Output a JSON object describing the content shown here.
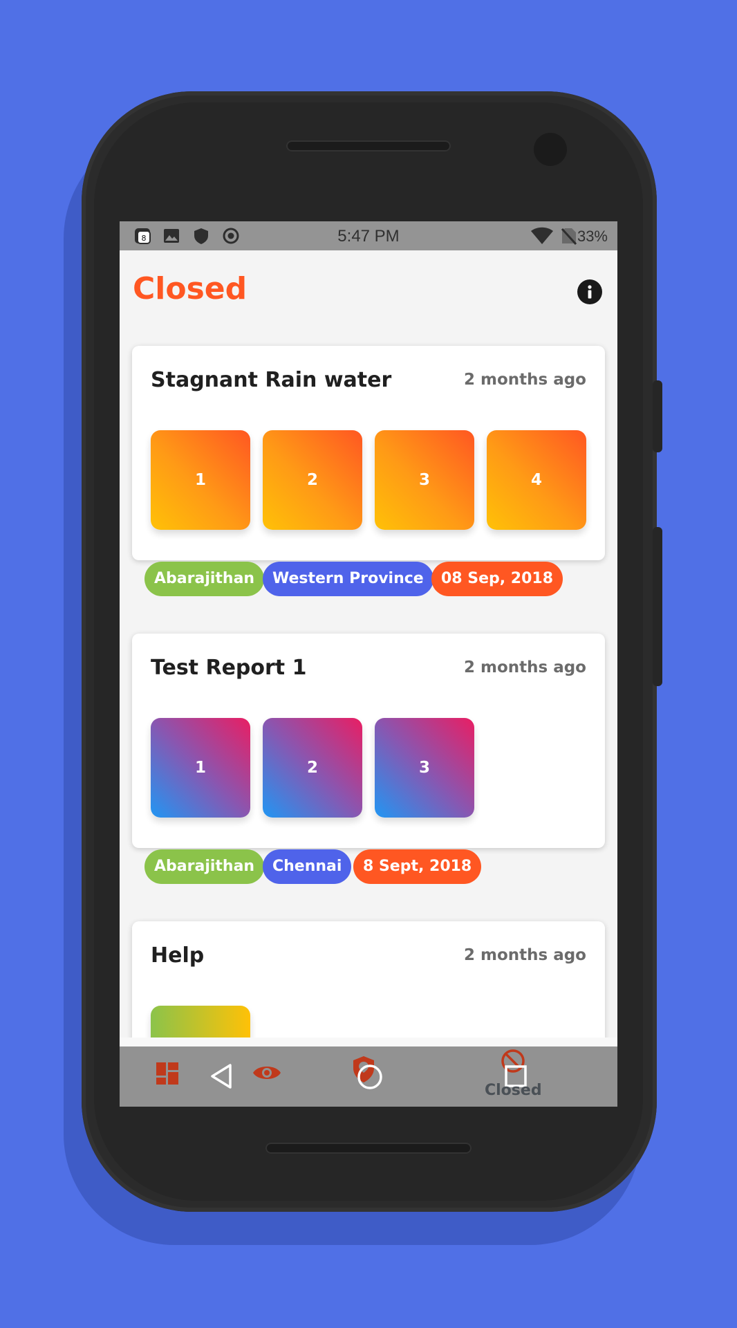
{
  "status_bar": {
    "time": "5:47 PM",
    "battery": "33%",
    "left_icons": [
      "notification-badge-icon",
      "image-icon",
      "shield-icon",
      "record-icon"
    ],
    "right_icons": [
      "wifi-icon",
      "no-sim-icon"
    ],
    "notification_count": "8"
  },
  "header": {
    "title": "Closed",
    "info_icon": "info-icon"
  },
  "reports": [
    {
      "title": "Stagnant Rain water",
      "time_ago": "2 months ago",
      "images": [
        "1",
        "2",
        "3",
        "4"
      ],
      "tags": {
        "user": "Abarajithan",
        "location": "Western Province",
        "date": "08 Sep, 2018"
      }
    },
    {
      "title": "Test Report 1",
      "time_ago": "2 months ago",
      "images": [
        "1",
        "2",
        "3"
      ],
      "tags": {
        "user": "Abarajithan",
        "location": "Chennai",
        "date": "8 Sept, 2018"
      }
    },
    {
      "title": "Help",
      "time_ago": "2 months ago",
      "images": [
        ""
      ]
    }
  ],
  "bottom_nav": {
    "items": [
      "dashboard-icon",
      "eye-icon",
      "shield-icon",
      "blocked-icon"
    ],
    "active_label": "Closed"
  },
  "system_nav": [
    "back-icon",
    "home-icon",
    "recents-icon"
  ],
  "colors": {
    "background": "#5070e6",
    "accent": "#ff5722",
    "chip_green": "#8bc34a",
    "chip_blue": "#4f63ea",
    "chip_red": "#ff5722"
  }
}
